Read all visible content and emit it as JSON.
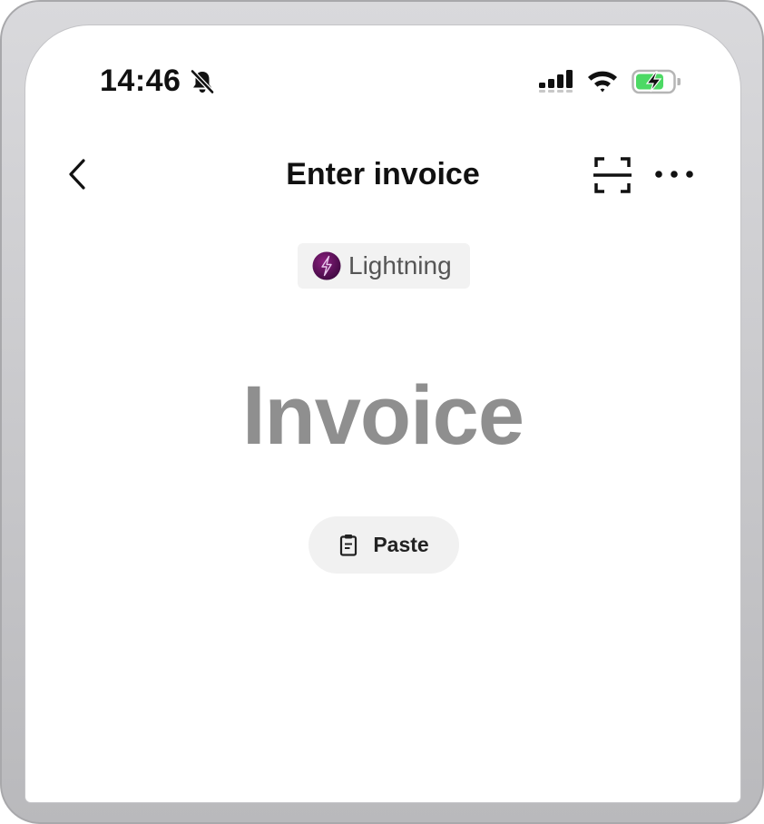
{
  "status_bar": {
    "time": "14:46",
    "icons": [
      "bell-muted-icon",
      "cellular-signal-icon",
      "wifi-icon",
      "battery-charging-icon"
    ]
  },
  "nav": {
    "title": "Enter invoice",
    "back_icon": "chevron-left-icon",
    "scan_icon": "scan-icon",
    "more_icon": "more-horizontal-icon"
  },
  "network": {
    "label": "Lightning",
    "icon": "lightning-bolt-icon",
    "icon_color": "#5a0f5a"
  },
  "input": {
    "placeholder": "Invoice"
  },
  "paste": {
    "label": "Paste",
    "icon": "clipboard-icon"
  },
  "colors": {
    "battery_fill": "#4cd964",
    "text_primary": "#111111",
    "placeholder": "#8f8f8f",
    "chip_background": "#f2f2f2"
  }
}
